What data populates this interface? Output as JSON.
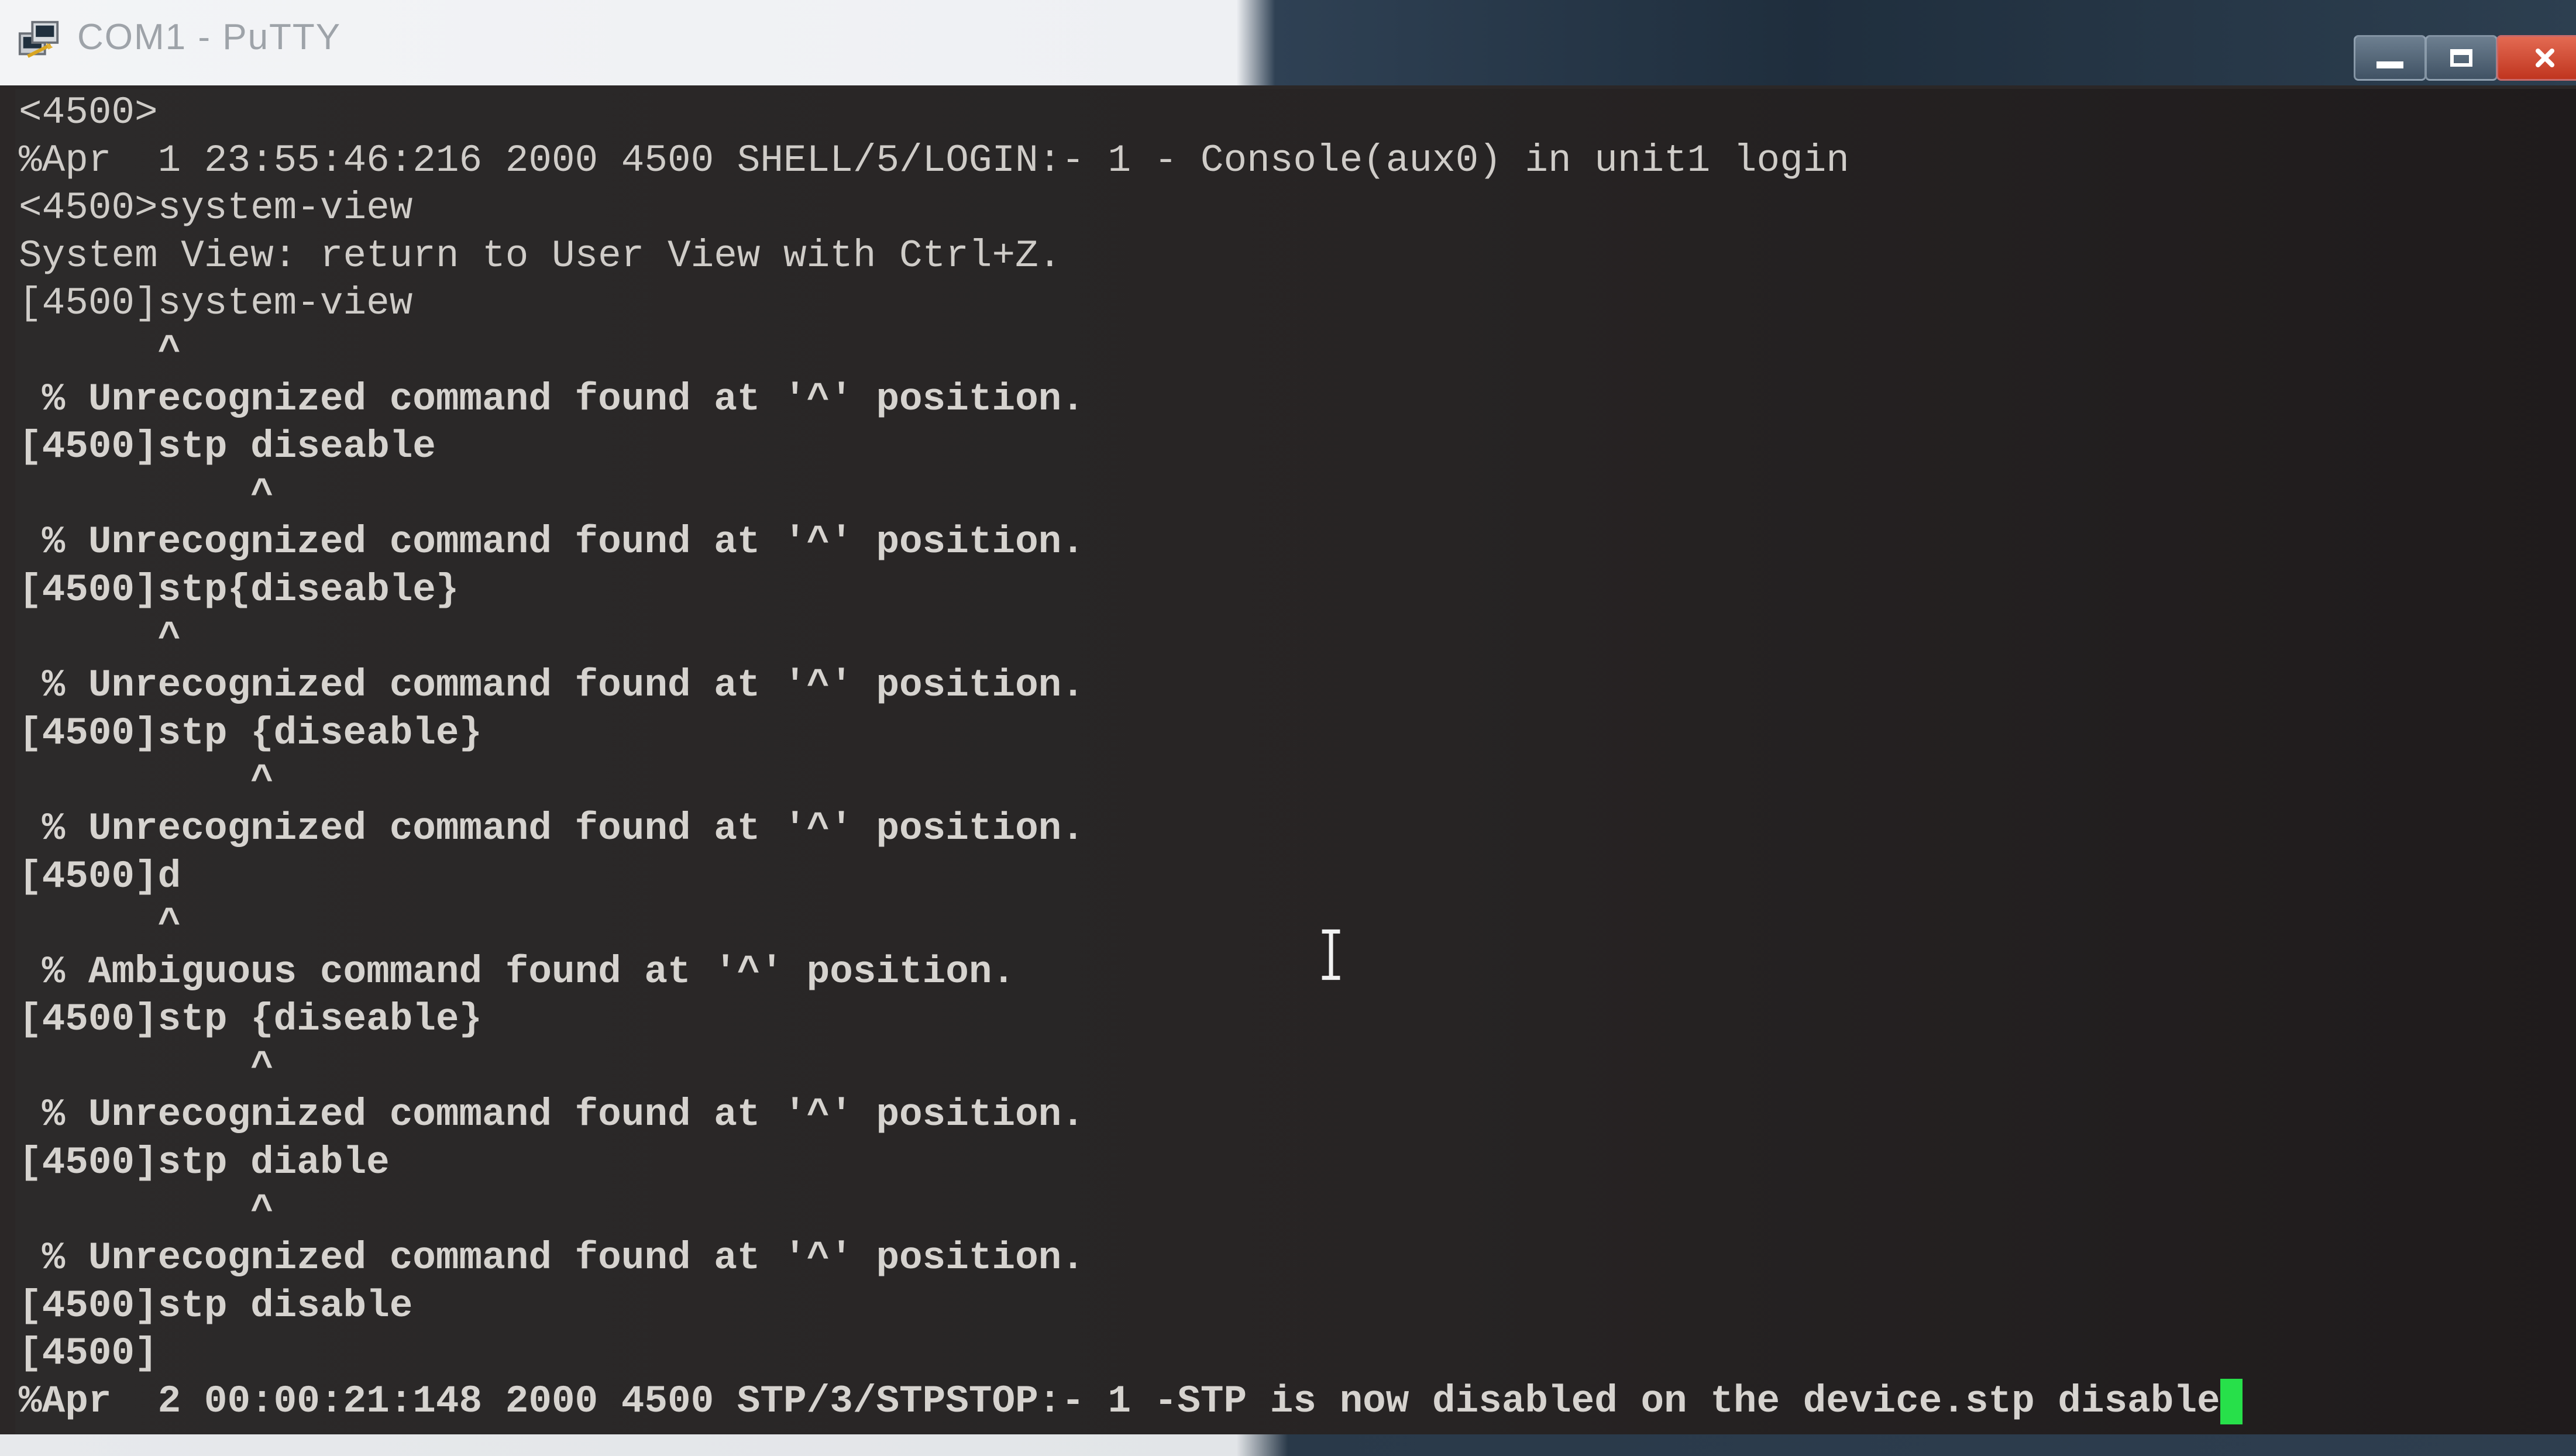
{
  "window": {
    "title": "COM1 - PuTTY"
  },
  "icons": {
    "app": "putty-icon",
    "minimize": "minimize-icon",
    "maximize": "maximize-icon",
    "close": "close-icon",
    "text_cursor": "ibeam-cursor-icon"
  },
  "colors": {
    "terminal_bg": "#2b2727",
    "terminal_text": "#d6d3cf",
    "cursor": "#27e04a",
    "close_button": "#c0351f"
  },
  "terminal": {
    "lines": [
      "<4500>",
      "%Apr  1 23:55:46:216 2000 4500 SHELL/5/LOGIN:- 1 - Console(aux0) in unit1 login",
      "<4500>system-view",
      "System View: return to User View with Ctrl+Z.",
      "[4500]system-view",
      "      ^",
      " % Unrecognized command found at '^' position.",
      "[4500]stp diseable",
      "          ^",
      " % Unrecognized command found at '^' position.",
      "[4500]stp{diseable}",
      "      ^",
      " % Unrecognized command found at '^' position.",
      "[4500]stp {diseable}",
      "          ^",
      " % Unrecognized command found at '^' position.",
      "[4500]d",
      "      ^",
      " % Ambiguous command found at '^' position.",
      "[4500]stp {diseable}",
      "          ^",
      " % Unrecognized command found at '^' position.",
      "[4500]stp diable",
      "          ^",
      " % Unrecognized command found at '^' position.",
      "[4500]stp disable",
      "[4500]",
      "%Apr  2 00:00:21:148 2000 4500 STP/3/STPSTOP:- 1 -STP is now disabled on the device.stp disable"
    ]
  }
}
